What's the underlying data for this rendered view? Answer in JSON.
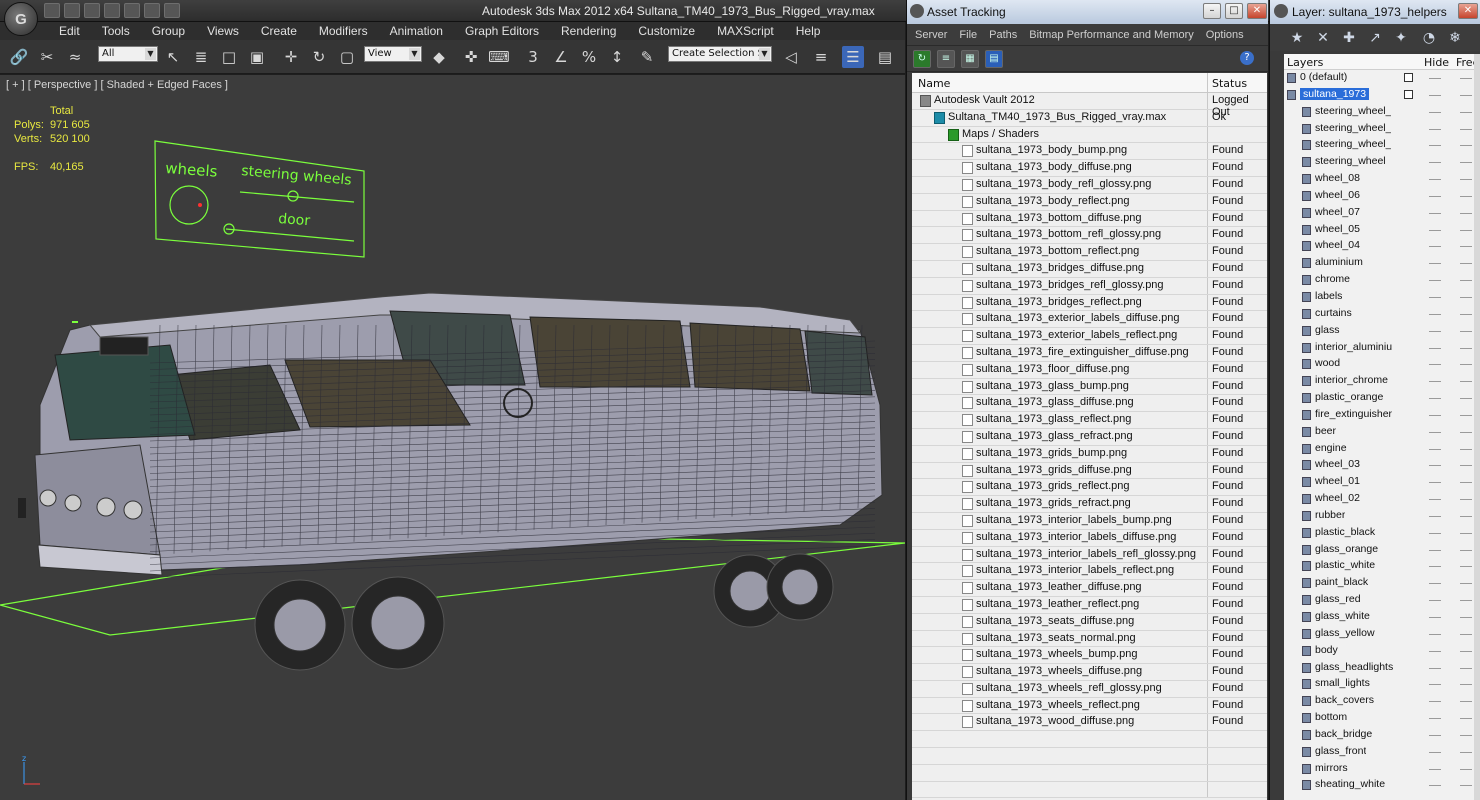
{
  "app": {
    "window_title": "Autodesk 3ds Max  2012 x64     Sultana_TM40_1973_Bus_Rigged_vray.max",
    "menu": [
      "Edit",
      "Tools",
      "Group",
      "Views",
      "Create",
      "Modifiers",
      "Animation",
      "Graph Editors",
      "Rendering",
      "Customize",
      "MAXScript",
      "Help"
    ],
    "selection_filter": "All",
    "ref_coord": "View",
    "selection_set": "Create Selection Se",
    "snap_labels": [
      "3",
      "%"
    ]
  },
  "viewport": {
    "label": "[ + ] [ Perspective ] [ Shaded + Edged Faces ]",
    "stats": {
      "total_label": "Total",
      "polys_label": "Polys:",
      "polys_value": "971 605",
      "verts_label": "Verts:",
      "verts_value": "520 100",
      "fps_label": "FPS:",
      "fps_value": "40,165"
    },
    "rig_panel": {
      "wheels_label": "wheels",
      "steering_label": "steering wheels",
      "door_label": "door"
    },
    "colors": {
      "background": "#3c3c3c",
      "stats": "#e8e840",
      "rig": "#7bff3c",
      "mesh": "#ffffff",
      "bus": "#9a9aab"
    }
  },
  "asset_tracking": {
    "title": "Asset Tracking",
    "menu": [
      "Server",
      "File",
      "Paths",
      "Bitmap Performance and Memory",
      "Options"
    ],
    "columns": {
      "name": "Name",
      "status": "Status"
    },
    "rows": [
      {
        "name": "Autodesk Vault 2012",
        "status": "Logged Out",
        "indent": 0,
        "icon": "vault"
      },
      {
        "name": "Sultana_TM40_1973_Bus_Rigged_vray.max",
        "status": "Ok",
        "indent": 1,
        "icon": "max"
      },
      {
        "name": "Maps / Shaders",
        "status": "",
        "indent": 2,
        "icon": "maps"
      },
      {
        "name": "sultana_1973_body_bump.png",
        "status": "Found",
        "indent": 3,
        "icon": "file"
      },
      {
        "name": "sultana_1973_body_diffuse.png",
        "status": "Found",
        "indent": 3,
        "icon": "file"
      },
      {
        "name": "sultana_1973_body_refl_glossy.png",
        "status": "Found",
        "indent": 3,
        "icon": "file"
      },
      {
        "name": "sultana_1973_body_reflect.png",
        "status": "Found",
        "indent": 3,
        "icon": "file"
      },
      {
        "name": "sultana_1973_bottom_diffuse.png",
        "status": "Found",
        "indent": 3,
        "icon": "file"
      },
      {
        "name": "sultana_1973_bottom_refl_glossy.png",
        "status": "Found",
        "indent": 3,
        "icon": "file"
      },
      {
        "name": "sultana_1973_bottom_reflect.png",
        "status": "Found",
        "indent": 3,
        "icon": "file"
      },
      {
        "name": "sultana_1973_bridges_diffuse.png",
        "status": "Found",
        "indent": 3,
        "icon": "file"
      },
      {
        "name": "sultana_1973_bridges_refl_glossy.png",
        "status": "Found",
        "indent": 3,
        "icon": "file"
      },
      {
        "name": "sultana_1973_bridges_reflect.png",
        "status": "Found",
        "indent": 3,
        "icon": "file"
      },
      {
        "name": "sultana_1973_exterior_labels_diffuse.png",
        "status": "Found",
        "indent": 3,
        "icon": "file"
      },
      {
        "name": "sultana_1973_exterior_labels_reflect.png",
        "status": "Found",
        "indent": 3,
        "icon": "file"
      },
      {
        "name": "sultana_1973_fire_extinguisher_diffuse.png",
        "status": "Found",
        "indent": 3,
        "icon": "file"
      },
      {
        "name": "sultana_1973_floor_diffuse.png",
        "status": "Found",
        "indent": 3,
        "icon": "file"
      },
      {
        "name": "sultana_1973_glass_bump.png",
        "status": "Found",
        "indent": 3,
        "icon": "file"
      },
      {
        "name": "sultana_1973_glass_diffuse.png",
        "status": "Found",
        "indent": 3,
        "icon": "file"
      },
      {
        "name": "sultana_1973_glass_reflect.png",
        "status": "Found",
        "indent": 3,
        "icon": "file"
      },
      {
        "name": "sultana_1973_glass_refract.png",
        "status": "Found",
        "indent": 3,
        "icon": "file"
      },
      {
        "name": "sultana_1973_grids_bump.png",
        "status": "Found",
        "indent": 3,
        "icon": "file"
      },
      {
        "name": "sultana_1973_grids_diffuse.png",
        "status": "Found",
        "indent": 3,
        "icon": "file"
      },
      {
        "name": "sultana_1973_grids_reflect.png",
        "status": "Found",
        "indent": 3,
        "icon": "file"
      },
      {
        "name": "sultana_1973_grids_refract.png",
        "status": "Found",
        "indent": 3,
        "icon": "file"
      },
      {
        "name": "sultana_1973_interior_labels_bump.png",
        "status": "Found",
        "indent": 3,
        "icon": "file"
      },
      {
        "name": "sultana_1973_interior_labels_diffuse.png",
        "status": "Found",
        "indent": 3,
        "icon": "file"
      },
      {
        "name": "sultana_1973_interior_labels_refl_glossy.png",
        "status": "Found",
        "indent": 3,
        "icon": "file"
      },
      {
        "name": "sultana_1973_interior_labels_reflect.png",
        "status": "Found",
        "indent": 3,
        "icon": "file"
      },
      {
        "name": "sultana_1973_leather_diffuse.png",
        "status": "Found",
        "indent": 3,
        "icon": "file"
      },
      {
        "name": "sultana_1973_leather_reflect.png",
        "status": "Found",
        "indent": 3,
        "icon": "file"
      },
      {
        "name": "sultana_1973_seats_diffuse.png",
        "status": "Found",
        "indent": 3,
        "icon": "file"
      },
      {
        "name": "sultana_1973_seats_normal.png",
        "status": "Found",
        "indent": 3,
        "icon": "file"
      },
      {
        "name": "sultana_1973_wheels_bump.png",
        "status": "Found",
        "indent": 3,
        "icon": "file"
      },
      {
        "name": "sultana_1973_wheels_diffuse.png",
        "status": "Found",
        "indent": 3,
        "icon": "file"
      },
      {
        "name": "sultana_1973_wheels_refl_glossy.png",
        "status": "Found",
        "indent": 3,
        "icon": "file"
      },
      {
        "name": "sultana_1973_wheels_reflect.png",
        "status": "Found",
        "indent": 3,
        "icon": "file"
      },
      {
        "name": "sultana_1973_wood_diffuse.png",
        "status": "Found",
        "indent": 3,
        "icon": "file"
      }
    ]
  },
  "layers": {
    "title": "Layer: sultana_1973_helpers",
    "columns": {
      "layers": "Layers",
      "hide": "Hide",
      "freeze": "Free"
    },
    "rows": [
      {
        "name": "0 (default)",
        "level": 0,
        "selected": false,
        "check": true
      },
      {
        "name": "sultana_1973",
        "level": 0,
        "selected": true,
        "check": true
      },
      {
        "name": "steering_wheel_",
        "level": 1
      },
      {
        "name": "steering_wheel_",
        "level": 1
      },
      {
        "name": "steering_wheel_",
        "level": 1
      },
      {
        "name": "steering_wheel",
        "level": 1
      },
      {
        "name": "wheel_08",
        "level": 1
      },
      {
        "name": "wheel_06",
        "level": 1
      },
      {
        "name": "wheel_07",
        "level": 1
      },
      {
        "name": "wheel_05",
        "level": 1
      },
      {
        "name": "wheel_04",
        "level": 1
      },
      {
        "name": "aluminium",
        "level": 1
      },
      {
        "name": "chrome",
        "level": 1
      },
      {
        "name": "labels",
        "level": 1
      },
      {
        "name": "curtains",
        "level": 1
      },
      {
        "name": "glass",
        "level": 1
      },
      {
        "name": "interior_aluminiu",
        "level": 1
      },
      {
        "name": "wood",
        "level": 1
      },
      {
        "name": "interior_chrome",
        "level": 1
      },
      {
        "name": "plastic_orange",
        "level": 1
      },
      {
        "name": "fire_extinguisher",
        "level": 1
      },
      {
        "name": "beer",
        "level": 1
      },
      {
        "name": "engine",
        "level": 1
      },
      {
        "name": "wheel_03",
        "level": 1
      },
      {
        "name": "wheel_01",
        "level": 1
      },
      {
        "name": "wheel_02",
        "level": 1
      },
      {
        "name": "rubber",
        "level": 1
      },
      {
        "name": "plastic_black",
        "level": 1
      },
      {
        "name": "glass_orange",
        "level": 1
      },
      {
        "name": "plastic_white",
        "level": 1
      },
      {
        "name": "paint_black",
        "level": 1
      },
      {
        "name": "glass_red",
        "level": 1
      },
      {
        "name": "glass_white",
        "level": 1
      },
      {
        "name": "glass_yellow",
        "level": 1
      },
      {
        "name": "body",
        "level": 1
      },
      {
        "name": "glass_headlights",
        "level": 1
      },
      {
        "name": "small_lights",
        "level": 1
      },
      {
        "name": "back_covers",
        "level": 1
      },
      {
        "name": "bottom",
        "level": 1
      },
      {
        "name": "back_bridge",
        "level": 1
      },
      {
        "name": "glass_front",
        "level": 1
      },
      {
        "name": "mirrors",
        "level": 1
      },
      {
        "name": "sheating_white",
        "level": 1
      }
    ]
  }
}
